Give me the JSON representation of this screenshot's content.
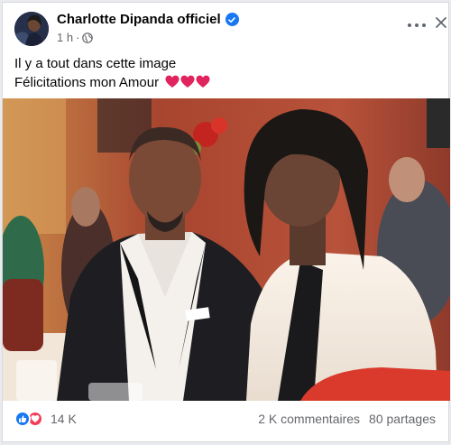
{
  "post": {
    "author": "Charlotte Dipanda officiel",
    "timestamp": "1 h",
    "privacy_icon": "globe-icon",
    "caption_line1": "Il y a tout dans cette image",
    "caption_line2": "Félicitations mon Amour",
    "caption_emoji": [
      "heart-icon",
      "heart-icon",
      "heart-icon"
    ]
  },
  "reactions": {
    "icons": [
      "like-icon",
      "love-icon"
    ],
    "count": "14 K"
  },
  "stats": {
    "comments": "2 K commentaires",
    "shares": "80 partages"
  },
  "colors": {
    "brand_blue": "#1877f2",
    "love_red": "#f33e58",
    "secondary_text": "#65676b"
  }
}
